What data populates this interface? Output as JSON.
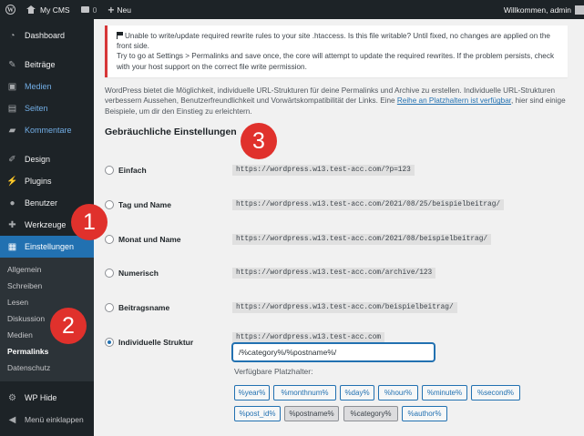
{
  "adminbar": {
    "logo_icon": "wordpress-icon",
    "site_name": "My CMS",
    "comment_count": "0",
    "new_label": "Neu",
    "greeting": "Willkommen, admin"
  },
  "sidebar": {
    "items": [
      {
        "label": "Dashboard",
        "icon": "dashboard-icon"
      },
      {
        "label": "Beiträge",
        "icon": "pin-icon"
      },
      {
        "label": "Medien",
        "icon": "media-icon"
      },
      {
        "label": "Seiten",
        "icon": "page-icon"
      },
      {
        "label": "Kommentare",
        "icon": "comment-icon"
      },
      {
        "label": "Design",
        "icon": "brush-icon"
      },
      {
        "label": "Plugins",
        "icon": "plugin-icon"
      },
      {
        "label": "Benutzer",
        "icon": "users-icon"
      },
      {
        "label": "Werkzeuge",
        "icon": "wrench-icon"
      },
      {
        "label": "Einstellungen",
        "icon": "settings-icon"
      }
    ],
    "submenu": [
      "Allgemein",
      "Schreiben",
      "Lesen",
      "Diskussion",
      "Medien",
      "Permalinks",
      "Datenschutz"
    ],
    "extra": [
      {
        "label": "WP Hide",
        "icon": "gear-icon"
      },
      {
        "label": "Menü einklappen",
        "icon": "collapse-icon"
      }
    ]
  },
  "notice": {
    "line1": "Unable to write/update required rewrite rules to your site .htaccess. Is this file writable? Until fixed, no changes are applied on the front side.",
    "line2": "Try to go at Settings > Permalinks and save once, the core will attempt to update the required rewrites. If the problem persists, check with your host support on the correct file write permission."
  },
  "intro": {
    "text": "WordPress bietet die Möglichkeit, individuelle URL-Strukturen für deine Permalinks und Archive zu erstellen. Individuelle URL-Strukturen verbessern Aussehen, Benutzerfreundlichkeit und Vorwärtskompatibilität der Links. Eine ",
    "link": "Reihe an Platzhaltern ist verfügbar",
    "text_after": ", hier sind einige Beispiele, um dir den Einstieg zu erleichtern."
  },
  "section_title": "Gebräuchliche Einstellungen",
  "options": [
    {
      "label": "Einfach",
      "example": "https://wordpress.w13.test-acc.com/?p=123",
      "checked": false
    },
    {
      "label": "Tag und Name",
      "example": "https://wordpress.w13.test-acc.com/2021/08/25/beispielbeitrag/",
      "checked": false
    },
    {
      "label": "Monat und Name",
      "example": "https://wordpress.w13.test-acc.com/2021/08/beispielbeitrag/",
      "checked": false
    },
    {
      "label": "Numerisch",
      "example": "https://wordpress.w13.test-acc.com/archive/123",
      "checked": false
    },
    {
      "label": "Beitragsname",
      "example": "https://wordpress.w13.test-acc.com/beispielbeitrag/",
      "checked": false
    },
    {
      "label": "Individuelle Struktur",
      "example": "https://wordpress.w13.test-acc.com",
      "checked": true
    }
  ],
  "custom_structure": {
    "value": "/%category%/%postname%/",
    "placeholders_heading": "Verfügbare Platzhalter:",
    "tags_row1": [
      "%year%",
      "%monthnum%",
      "%day%",
      "%hour%",
      "%minute%",
      "%second%"
    ],
    "tags_row2": [
      "%post_id%",
      "%postname%",
      "%category%",
      "%author%"
    ],
    "active_tags": [
      "%postname%",
      "%category%"
    ]
  },
  "steps": [
    "1",
    "2",
    "3"
  ],
  "colors": {
    "sidebar_bg": "#1d2327",
    "accent": "#2271b1",
    "notice_error": "#d63638",
    "step_badge": "#e0312c"
  }
}
